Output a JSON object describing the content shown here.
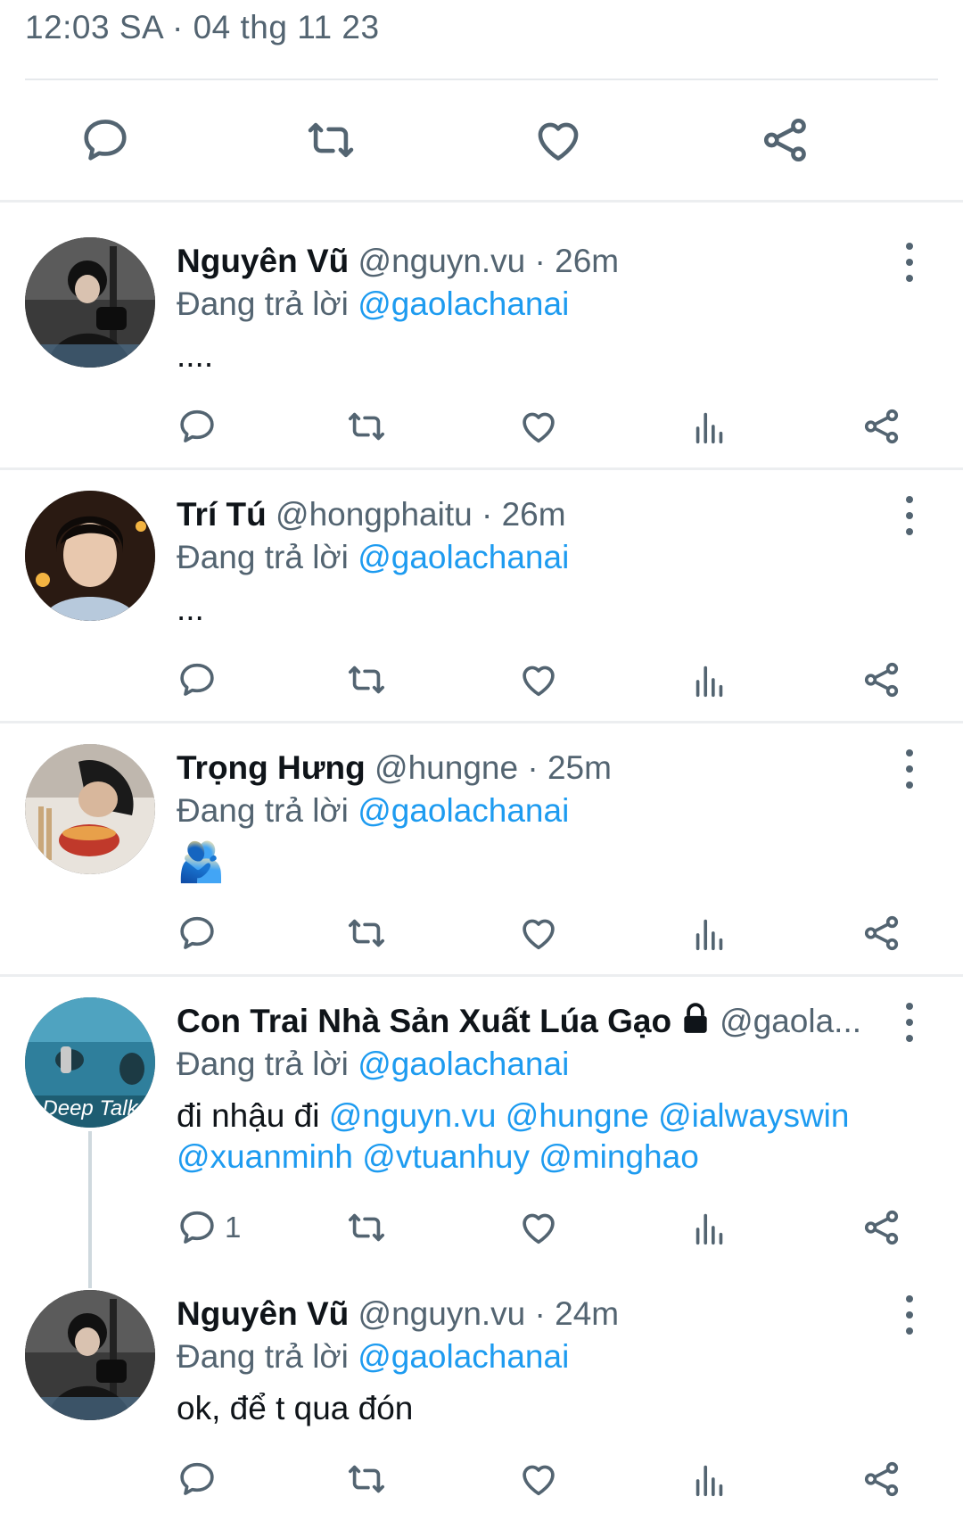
{
  "header": {
    "timestamp": "12:03 SA · 04 thg 11 23",
    "actions": [
      "reply-icon",
      "retweet-icon",
      "like-icon",
      "share-icon"
    ]
  },
  "colors": {
    "mention": "#1d9bf0",
    "muted": "#536471",
    "text": "#0f1419",
    "divider": "#eceef0"
  },
  "reply_prefix": "Đang trả lời",
  "replies": [
    {
      "name": "Nguyên Vũ",
      "handle": "@nguyn.vu · 26m",
      "replying_to": "@gaolachanai",
      "text": "....",
      "reply_count": ""
    },
    {
      "name": "Trí Tú",
      "handle": "@hongphaitu · 26m",
      "replying_to": "@gaolachanai",
      "text": "...",
      "reply_count": ""
    },
    {
      "name": "Trọng Hưng",
      "handle": "@hungne · 25m",
      "replying_to": "@gaolachanai",
      "text": "🫂",
      "reply_count": ""
    },
    {
      "name": "Con Trai Nhà Sản Xuất Lúa Gạo",
      "handle": "@gaola...",
      "replying_to": "@gaolachanai",
      "text_prefix": "đi nhậu đi ",
      "text_mentions": "@nguyn.vu @hungne @ialwayswin @xuanminh @vtuanhuy @minghao",
      "avatar_label": "Deep Talk",
      "reply_count": "1"
    },
    {
      "name": "Nguyên Vũ",
      "handle": "@nguyn.vu · 24m",
      "replying_to": "@gaolachanai",
      "text": "ok, để t qua đón",
      "reply_count": ""
    }
  ]
}
